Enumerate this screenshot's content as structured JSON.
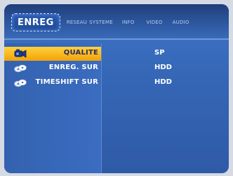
{
  "header": {
    "active_tab": "ENREG",
    "tabs": [
      "RESEAU",
      "SYSTEME",
      "INFO",
      "VIDEO",
      "AUDIO"
    ]
  },
  "settings": [
    {
      "label": "QUALITE",
      "value": "SP",
      "icon": "camcorder-icon",
      "selected": true
    },
    {
      "label": "ENREG. SUR",
      "value": "HDD",
      "icon": "disc-icon",
      "selected": false
    },
    {
      "label": "TIMESHIFT SUR",
      "value": "HDD",
      "icon": "disc-icon",
      "selected": false
    }
  ],
  "colors": {
    "panel": "#3566b6",
    "selection": "#f7b81e",
    "text": "#ffffff"
  }
}
